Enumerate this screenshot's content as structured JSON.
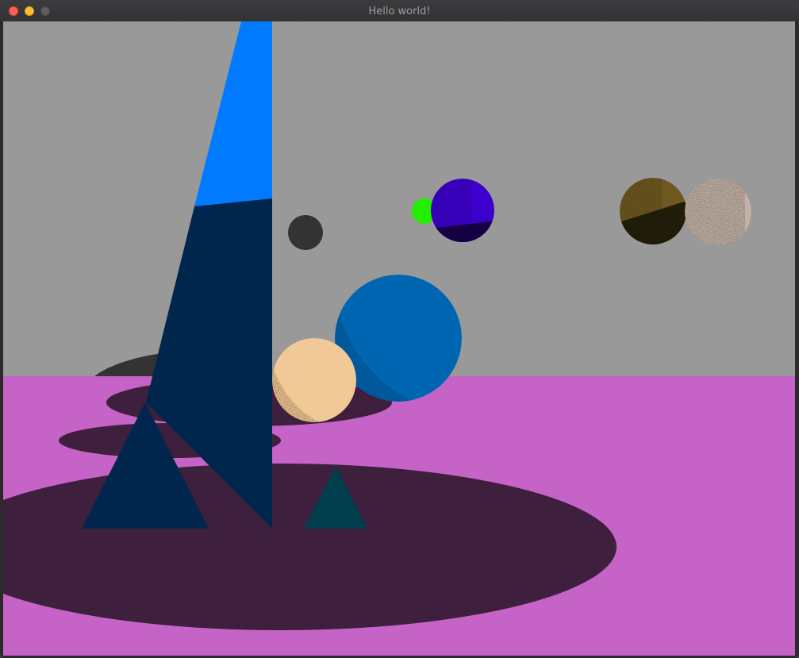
{
  "window": {
    "title": "Hello world!",
    "controls": [
      "close",
      "minimize",
      "maximize"
    ]
  },
  "scene": {
    "colors": {
      "background": "#999999",
      "floor": "#c563c6",
      "shadow": "#3e1f3d",
      "dark_shadow": "#333333",
      "tall_quad_light": "#007bff",
      "tall_quad_dark": "#00264d",
      "triangle_left": "#00264d",
      "triangle_right": "#003d4d",
      "sphere_gray": "#333333",
      "sphere_green": "#22ee00",
      "sphere_purple": "#3d00cc",
      "sphere_purple_dark": "#150044",
      "sphere_gold": "#6e5820",
      "sphere_gold_dark": "#201c0a",
      "sphere_speckled": "#c4b1a5",
      "sphere_blue": "#0066b2",
      "sphere_peach": "#f1c997"
    },
    "objects": [
      "floor-plane",
      "tall-quad",
      "triangle-left",
      "triangle-right",
      "sphere-gray",
      "sphere-green",
      "sphere-purple",
      "sphere-gold",
      "sphere-speckled",
      "sphere-blue",
      "sphere-peach"
    ]
  }
}
